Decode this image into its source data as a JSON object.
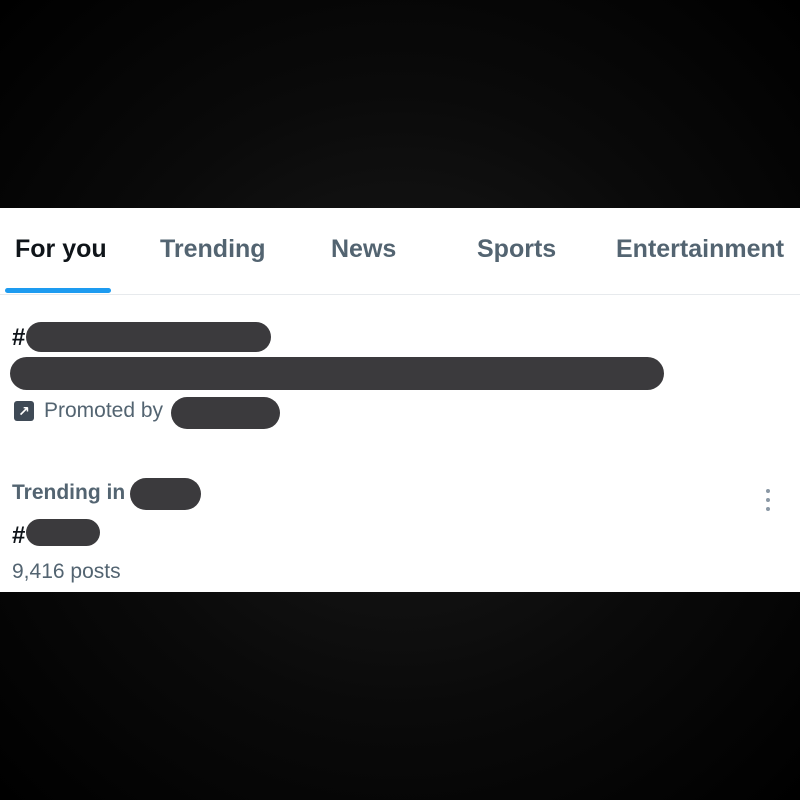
{
  "tabs": [
    {
      "label": "For you",
      "active": true
    },
    {
      "label": "Trending",
      "active": false
    },
    {
      "label": "News",
      "active": false
    },
    {
      "label": "Sports",
      "active": false
    },
    {
      "label": "Entertainment",
      "active": false
    }
  ],
  "promoted_trend": {
    "hash_symbol": "#",
    "promoted_label": "Promoted by",
    "icon": "promoted-arrow-icon"
  },
  "trend": {
    "context_label": "Trending in",
    "hash_symbol": "#",
    "post_count": "9,416 posts",
    "more_icon": "more-vertical-icon"
  },
  "colors": {
    "accent": "#1d9bf0",
    "text_primary": "#0f1419",
    "text_secondary": "#536471",
    "redaction": "#3b3a3d"
  }
}
